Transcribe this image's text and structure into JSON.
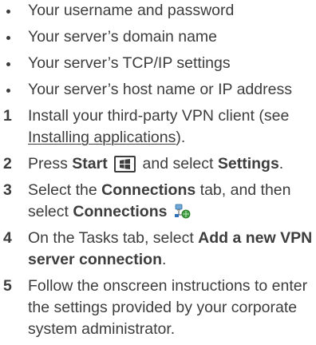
{
  "bullets": [
    "Your username and password",
    "Your server’s domain name",
    "Your server’s TCP/IP settings",
    "Your server’s host name or IP address"
  ],
  "steps": [
    {
      "num": "1",
      "text_before": "Install your third-party VPN client (see ",
      "link": "Installing applications",
      "text_after": ")."
    },
    {
      "num": "2",
      "text_a": "Press ",
      "bold_a": "Start",
      "text_b": " and select ",
      "bold_b": "Settings",
      "text_c": "."
    },
    {
      "num": "3",
      "text_a": "Select the ",
      "bold_a": "Connections",
      "text_b": " tab, and then select ",
      "bold_b": "Connections"
    },
    {
      "num": "4",
      "text_a": "On the Tasks tab, select ",
      "bold_a": "Add a new VPN server connection",
      "text_b": "."
    },
    {
      "num": "5",
      "text_a": "Follow the onscreen instructions to enter the settings provided by your corporate system administrator."
    }
  ],
  "icons": {
    "start_key": "windows-start-key-icon",
    "connections": "connections-network-icon"
  },
  "colors": {
    "text": "#3d3d3d"
  }
}
